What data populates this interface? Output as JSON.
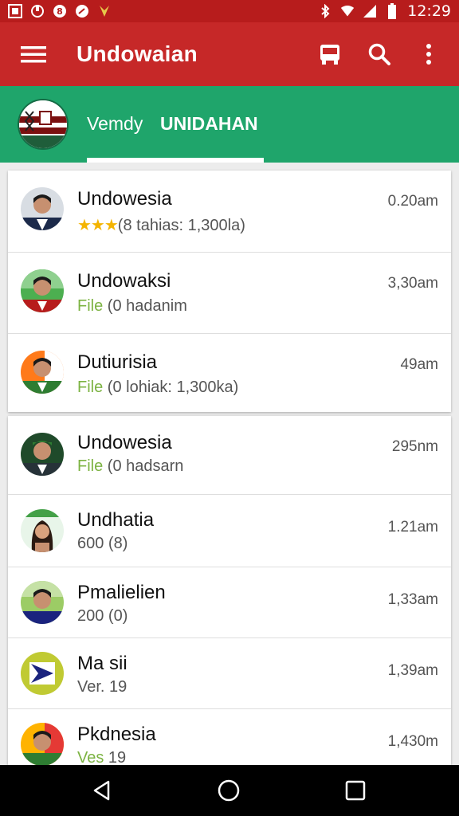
{
  "status_bar": {
    "time": "12:29",
    "left_icons": [
      "image-notification-icon",
      "sync-notification-icon",
      "app-notification-icon",
      "chat-notification-icon",
      "leaf-notification-icon"
    ],
    "right_icons": [
      "bluetooth-icon",
      "wifi-icon",
      "signal-icon",
      "battery-icon"
    ]
  },
  "app_bar": {
    "title": "Undowaian",
    "actions": [
      "bus-icon",
      "search-icon",
      "more-vert-icon"
    ]
  },
  "tab_header": {
    "sub_label": "Vemdy",
    "main_label": "UNIDAHAN"
  },
  "colors": {
    "status_bar": "#b71c1c",
    "app_bar": "#c62828",
    "tab_bar": "#1fa56b",
    "highlight_green": "#7cb342",
    "star_gold": "#f4b400"
  },
  "list_group_1": [
    {
      "name": "Undowesia",
      "stars": "★★★",
      "subtitle": "(8 tahias: 1,300la)",
      "time": "0.20am"
    },
    {
      "name": "Undowaksi",
      "highlight": "File",
      "subtitle": " (0 hadanim",
      "time": "3,30am"
    },
    {
      "name": "Dutiurisia",
      "highlight": "File",
      "subtitle": " (0 lohiak: 1,300ka)",
      "time": "49am"
    }
  ],
  "list_group_2": [
    {
      "name": "Undowesia",
      "highlight": "File",
      "subtitle": " (0 hadsarn",
      "time": "295nm"
    },
    {
      "name": "Undhatia",
      "highlight": "",
      "subtitle": "600 (8)",
      "time": "1.21am"
    },
    {
      "name": "Pmalielien",
      "highlight": "",
      "subtitle": "200 (0)",
      "time": "1,33am"
    },
    {
      "name": "Ma sii",
      "highlight": "",
      "subtitle": "Ver. 19",
      "time": "1,39am"
    },
    {
      "name": "Pkdnesia",
      "highlight": "Ves",
      "subtitle": " 19",
      "time": "1,430m"
    }
  ]
}
